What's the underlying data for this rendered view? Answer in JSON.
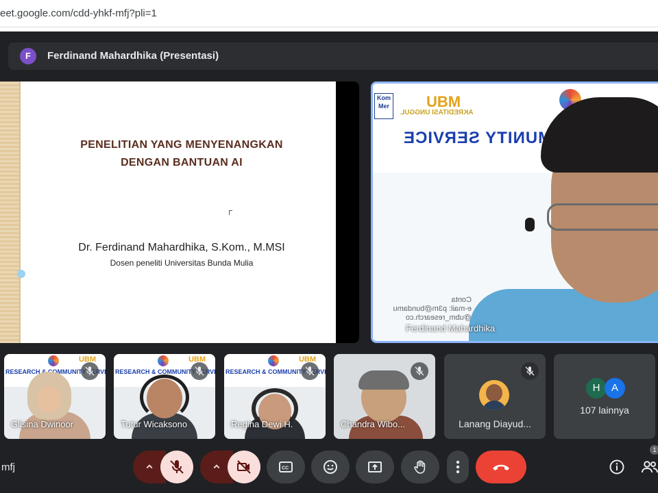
{
  "browser": {
    "url": "eet.google.com/cdd-yhkf-mfj?pli=1"
  },
  "presenter_bar": {
    "avatar_letter": "F",
    "name": "Ferdinand Mahardhika (Presentasi)"
  },
  "slide": {
    "title_line1": "PENELITIAN YANG MENYENANGKAN",
    "title_line2": "DENGAN BANTUAN AI",
    "author": "Dr. Ferdinand Mahardhika, S.Kom., M.MSI",
    "affiliation": "Dosen peneliti Universitas Bunda Mulia"
  },
  "main_camera": {
    "banner_ubm": "UBM",
    "banner_akreditasi": "AKREDITASI UNGGUL",
    "banner_kom": "Kom Mer",
    "banner_service": "MUNITY SERVICE",
    "contact_line1": "Conta",
    "contact_line2": "e-mail: p3m@bundamu",
    "contact_line3": "@ubm_research.co",
    "participant_name": "Ferdinand Mahardhika"
  },
  "tiles": [
    {
      "name": "Glisina Dwinoor",
      "banner": "RESEARCH & COMMUNITY SERVICE",
      "ubm": "UBM",
      "muted": true
    },
    {
      "name": "Tutur Wicaksono",
      "banner": "RESEARCH & COMMUNITY SERVICE",
      "ubm": "UBM",
      "muted": true
    },
    {
      "name": "Regina Dewi H.",
      "banner": "RESEARCH & COMMUNITY SERVICE",
      "ubm": "UBM",
      "muted": true
    },
    {
      "name": "Chandra Wibo...",
      "muted": true
    },
    {
      "name": "Lanang Diayud...",
      "muted": true
    },
    {
      "name": "107 lainnya",
      "avatars": [
        "H",
        "A"
      ]
    }
  ],
  "controls": {
    "meeting_code": "mfj",
    "badge_count": "1"
  },
  "colors": {
    "background": "#202124",
    "hangup": "#ea4335",
    "muted_button": "#f9dedc",
    "speaking_border": "#8ab4f8",
    "avatar_purple": "#7b4fc8",
    "avatar_h": "#1e6b50",
    "avatar_a": "#1a73e8"
  },
  "icons": {
    "mic": "mic-off-icon",
    "camera": "videocam-off-icon",
    "captions": "closed-caption-icon",
    "emoji": "emoji-icon",
    "present": "present-screen-icon",
    "raise_hand": "hand-icon",
    "more": "more-vert-icon",
    "hangup": "call-end-icon",
    "info": "info-icon",
    "people": "people-icon"
  }
}
